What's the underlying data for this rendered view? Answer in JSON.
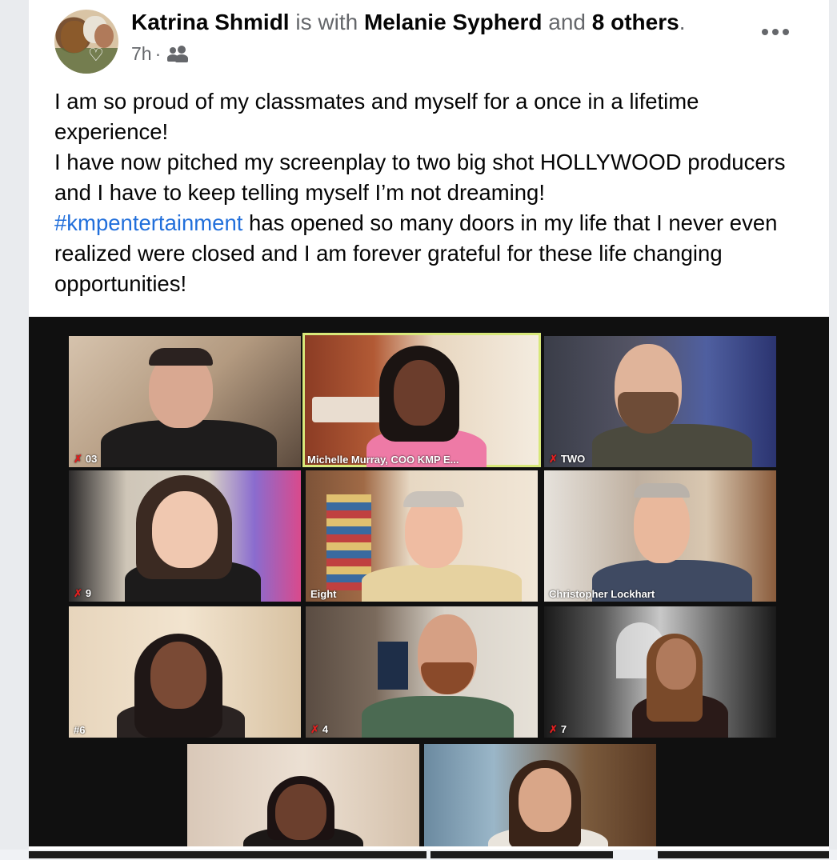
{
  "post": {
    "author": "Katrina Shmidl",
    "with_text": " is with ",
    "tagged": "Melanie Sypherd",
    "and_text": " and ",
    "others": "8 others",
    "period": ".",
    "time": "7h",
    "separator": " · ",
    "audience_icon": "friends-icon",
    "more_icon": "more-options-icon"
  },
  "body": {
    "line1": "I am so proud of my classmates and myself for a once in a lifetime experience!",
    "line2": "I have now pitched my screenplay to two big shot HOLLYWOOD producers and I have to keep telling myself I’m not dreaming!",
    "hashtag": "#kmpentertainment",
    "line3": " has opened so many doors in my life that I never even realized were closed and I am forever grateful for these life changing opportunities!"
  },
  "video_grid": {
    "tiles": [
      {
        "label": "03",
        "muted": true
      },
      {
        "label": "Michelle Murray, COO KMP E...",
        "muted": false,
        "active": true
      },
      {
        "label": "TWO",
        "muted": true
      },
      {
        "label": "9",
        "muted": true
      },
      {
        "label": "Eight",
        "muted": false
      },
      {
        "label": "Christopher Lockhart",
        "muted": false
      },
      {
        "label": "#6",
        "muted": false
      },
      {
        "label": "4",
        "muted": true
      },
      {
        "label": "7",
        "muted": true
      },
      {
        "label": "",
        "muted": false
      },
      {
        "label": "",
        "muted": false
      }
    ],
    "mute_glyph": "✗"
  },
  "colors": {
    "link": "#216fdb",
    "active_speaker": "#d8e87a",
    "muted": "#e02020"
  }
}
